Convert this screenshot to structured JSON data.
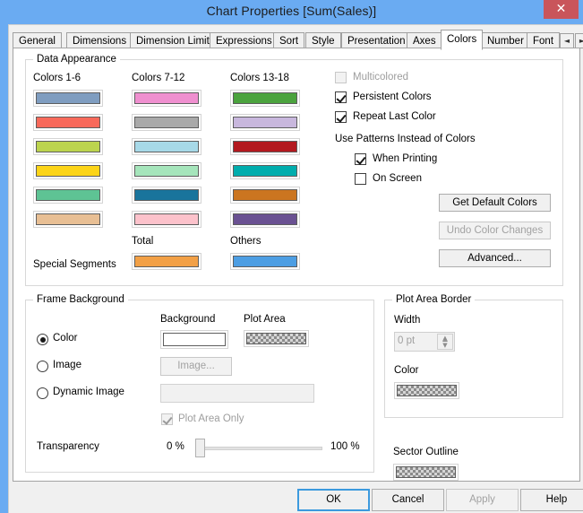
{
  "window": {
    "title": "Chart Properties [Sum(Sales)]",
    "close_label": "✕",
    "titlebar_color": "#6aabf2",
    "close_color": "#c9555b"
  },
  "tabs": {
    "items": [
      {
        "label": "General",
        "selected": false
      },
      {
        "label": "Dimensions",
        "selected": false
      },
      {
        "label": "Dimension Limits",
        "selected": false
      },
      {
        "label": "Expressions",
        "selected": false
      },
      {
        "label": "Sort",
        "selected": false
      },
      {
        "label": "Style",
        "selected": false
      },
      {
        "label": "Presentation",
        "selected": false
      },
      {
        "label": "Axes",
        "selected": false
      },
      {
        "label": "Colors",
        "selected": true
      },
      {
        "label": "Number",
        "selected": false
      },
      {
        "label": "Font",
        "selected": false
      }
    ],
    "scroll_left": "◄",
    "scroll_right": "►"
  },
  "data_appearance": {
    "group_title": "Data Appearance",
    "col1_header": "Colors 1-6",
    "col2_header": "Colors 7-12",
    "col3_header": "Colors 13-18",
    "colors_1_6": [
      "#7f9dc0",
      "#f8695a",
      "#bcd44e",
      "#fcd417",
      "#5ec394",
      "#e8bf94"
    ],
    "colors_7_12": [
      "#ef8fcf",
      "#a9a9a9",
      "#a7d9e8",
      "#a5e5bb",
      "#19749c",
      "#fcc2cb"
    ],
    "colors_13_18": [
      "#4ba33e",
      "#c8b7dd",
      "#b3191f",
      "#00adad",
      "#cb7520",
      "#6a5192"
    ],
    "special_segments_label": "Special Segments",
    "total_label": "Total",
    "total_color": "#f2a046",
    "others_label": "Others",
    "others_color": "#4d9ee3",
    "multicolored_label": "Multicolored",
    "multicolored_checked": false,
    "multicolored_disabled": true,
    "persistent_colors_label": "Persistent Colors",
    "persistent_colors_checked": true,
    "repeat_last_color_label": "Repeat Last Color",
    "repeat_last_color_checked": true,
    "use_patterns_label": "Use Patterns Instead of Colors",
    "when_printing_label": "When Printing",
    "when_printing_checked": true,
    "on_screen_label": "On Screen",
    "on_screen_checked": false,
    "get_default_colors_label": "Get Default Colors",
    "undo_color_changes_label": "Undo Color Changes",
    "undo_disabled": true,
    "advanced_label": "Advanced..."
  },
  "frame_background": {
    "group_title": "Frame Background",
    "background_label": "Background",
    "plot_area_label": "Plot Area",
    "color_radio_label": "Color",
    "color_radio_selected": true,
    "image_radio_label": "Image",
    "image_radio_selected": false,
    "dynamic_image_radio_label": "Dynamic Image",
    "dynamic_image_radio_selected": false,
    "image_button_label": "Image...",
    "image_button_disabled": true,
    "dynamic_image_value": "",
    "plot_area_only_label": "Plot Area Only",
    "plot_area_only_checked": true,
    "plot_area_only_disabled": true,
    "transparency_label": "Transparency",
    "transparency_min": "0 %",
    "transparency_max": "100 %",
    "transparency_value": 0,
    "background_swatch_color": "#ffffff"
  },
  "plot_area_border": {
    "group_title": "Plot Area Border",
    "width_label": "Width",
    "width_value": "0 pt",
    "width_disabled": true,
    "color_label": "Color",
    "spin_up": "▲",
    "spin_down": "▼"
  },
  "sector_outline": {
    "label": "Sector Outline"
  },
  "footer": {
    "ok_label": "OK",
    "cancel_label": "Cancel",
    "apply_label": "Apply",
    "apply_disabled": true,
    "help_label": "Help",
    "accent_color": "#3c9ade"
  }
}
